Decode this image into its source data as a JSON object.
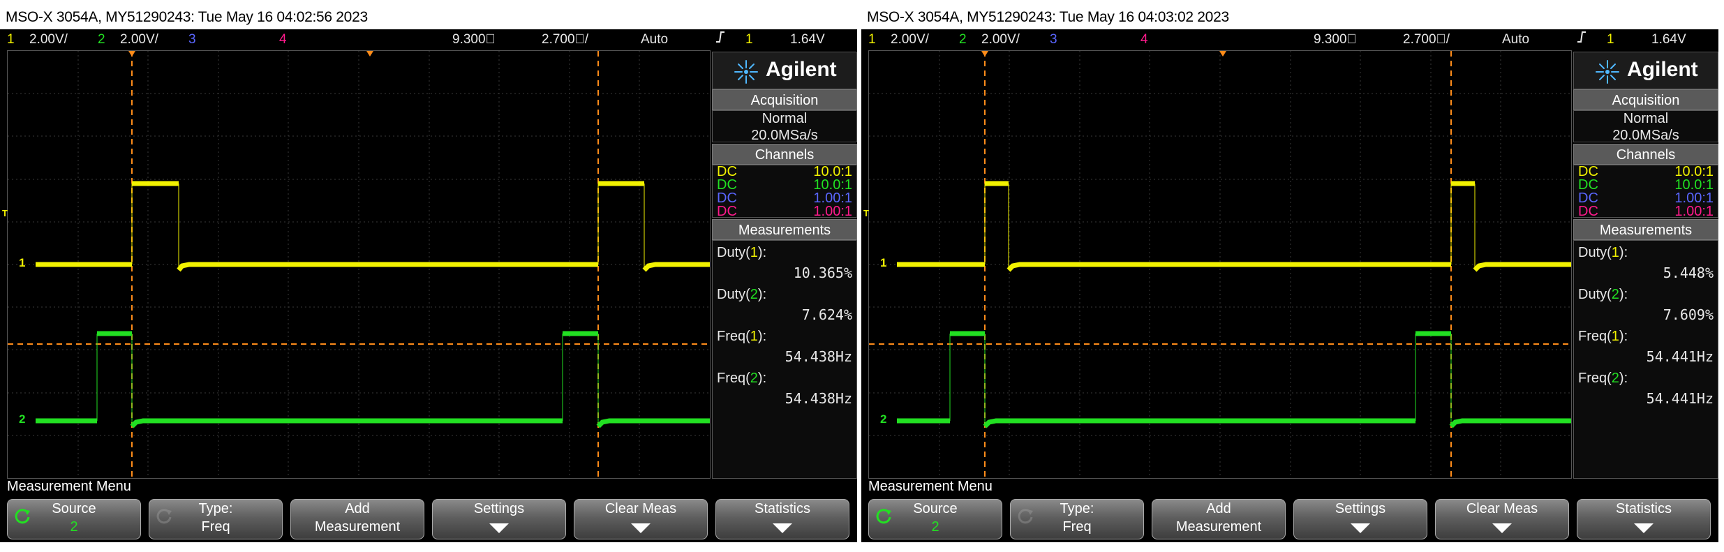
{
  "scopes": [
    {
      "title": "MSO-X 3054A, MY51290243: Tue May 16 04:02:56 2023",
      "topbar": {
        "ch1_num": "1",
        "ch1_scale": "2.00V/",
        "ch2_num": "2",
        "ch2_scale": "2.00V/",
        "ch3_num": "3",
        "ch4_num": "4",
        "time_pos": "9.300ﾟ",
        "time_scale": "2.700ﾟ/",
        "trigger_mode": "Auto",
        "trigger_source": "1",
        "trigger_level": "1.64V"
      },
      "logo": "Agilent",
      "acquisition": {
        "header": "Acquisition",
        "mode": "Normal",
        "rate": "20.0MSa/s"
      },
      "channels": {
        "header": "Channels",
        "rows": [
          {
            "coupling": "DC",
            "probe": "10.0:1",
            "color": "#f2f200"
          },
          {
            "coupling": "DC",
            "probe": "10.0:1",
            "color": "#22e022"
          },
          {
            "coupling": "DC",
            "probe": "1.00:1",
            "color": "#5a66ff"
          },
          {
            "coupling": "DC",
            "probe": "1.00:1",
            "color": "#ff1a8c"
          }
        ]
      },
      "measurements": {
        "header": "Measurements",
        "items": [
          {
            "label": "Duty",
            "ch": "1",
            "value": "10.365%"
          },
          {
            "label": "Duty",
            "ch": "2",
            "value": "7.624%"
          },
          {
            "label": "Freq",
            "ch": "1",
            "value": "54.438Hz"
          },
          {
            "label": "Freq",
            "ch": "2",
            "value": "54.438Hz"
          }
        ]
      },
      "menu_title": "Measurement Menu",
      "softkeys": [
        {
          "l1": "Source",
          "l2": "2"
        },
        {
          "l1": "Type:",
          "l2": "Freq"
        },
        {
          "l1": "Add",
          "l2": "Measurement"
        },
        {
          "l1": "Settings",
          "l2": ""
        },
        {
          "l1": "Clear Meas",
          "l2": ""
        },
        {
          "l1": "Statistics",
          "l2": ""
        }
      ],
      "markers": {
        "trig": "T",
        "ch1": "1",
        "ch2": "2"
      }
    },
    {
      "title": "MSO-X 3054A, MY51290243: Tue May 16 04:03:02 2023",
      "topbar": {
        "ch1_num": "1",
        "ch1_scale": "2.00V/",
        "ch2_num": "2",
        "ch2_scale": "2.00V/",
        "ch3_num": "3",
        "ch4_num": "4",
        "time_pos": "9.300ﾟ",
        "time_scale": "2.700ﾟ/",
        "trigger_mode": "Auto",
        "trigger_source": "1",
        "trigger_level": "1.64V"
      },
      "logo": "Agilent",
      "acquisition": {
        "header": "Acquisition",
        "mode": "Normal",
        "rate": "20.0MSa/s"
      },
      "channels": {
        "header": "Channels",
        "rows": [
          {
            "coupling": "DC",
            "probe": "10.0:1",
            "color": "#f2f200"
          },
          {
            "coupling": "DC",
            "probe": "10.0:1",
            "color": "#22e022"
          },
          {
            "coupling": "DC",
            "probe": "1.00:1",
            "color": "#5a66ff"
          },
          {
            "coupling": "DC",
            "probe": "1.00:1",
            "color": "#ff1a8c"
          }
        ]
      },
      "measurements": {
        "header": "Measurements",
        "items": [
          {
            "label": "Duty",
            "ch": "1",
            "value": "5.448%"
          },
          {
            "label": "Duty",
            "ch": "2",
            "value": "7.609%"
          },
          {
            "label": "Freq",
            "ch": "1",
            "value": "54.441Hz"
          },
          {
            "label": "Freq",
            "ch": "2",
            "value": "54.441Hz"
          }
        ]
      },
      "menu_title": "Measurement Menu",
      "softkeys": [
        {
          "l1": "Source",
          "l2": "2"
        },
        {
          "l1": "Type:",
          "l2": "Freq"
        },
        {
          "l1": "Add",
          "l2": "Measurement"
        },
        {
          "l1": "Settings",
          "l2": ""
        },
        {
          "l1": "Clear Meas",
          "l2": ""
        },
        {
          "l1": "Statistics",
          "l2": ""
        }
      ],
      "markers": {
        "trig": "T",
        "ch1": "1",
        "ch2": "2"
      }
    }
  ],
  "colors": {
    "ch1": "#f2f200",
    "ch2": "#22e022",
    "ch3": "#5a66ff",
    "ch4": "#ff1a8c",
    "cursor": "#ff8c1a"
  },
  "icons": {
    "trigger_edge": "rising-edge-icon",
    "source_cycle": "cycle-arrow-icon",
    "logo": "agilent-spark-icon"
  }
}
